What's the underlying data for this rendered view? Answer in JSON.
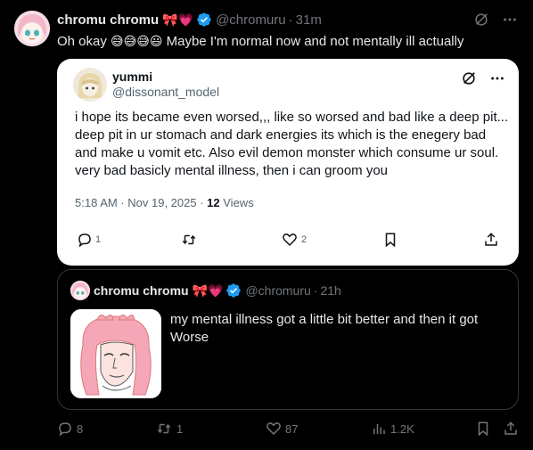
{
  "post": {
    "author_name": "chromu chromu",
    "author_badge_emoji": "🎀💗",
    "handle": "@chromuru",
    "separator": "·",
    "time": "31m",
    "text_before": "Oh okay",
    "text_emojis": "😅😅😅😃",
    "text_after": "Maybe I'm normal now and not mentally ill actually"
  },
  "quoted": {
    "author_name": "yummi",
    "handle": "@dissonant_model",
    "text": "i hope its became even worsed,,, like so worsed and bad like a deep pit... deep pit in ur stomach and dark energies its which is the enegery bad and make u vomit etc. Also evil demon monster which consume ur soul. very bad basicly mental illness, then i can groom you",
    "timestamp": "5:18 AM · Nov 19, 2025 ·",
    "views_count": "12",
    "views_label": "Views",
    "replies": "1",
    "likes": "2"
  },
  "nested_quote": {
    "author_name": "chromu chromu",
    "author_badge_emoji": "🎀💗",
    "handle": "@chromuru",
    "separator": "·",
    "time": "21h",
    "text": "my mental illness got a little bit better and then it got Worse"
  },
  "actions": {
    "replies": "8",
    "reposts": "1",
    "likes": "87",
    "views": "1.2K"
  },
  "colors": {
    "background": "#000000",
    "text": "#e7e9ea",
    "muted": "#71767b",
    "verified": "#1d9bf0",
    "border": "#333639"
  }
}
